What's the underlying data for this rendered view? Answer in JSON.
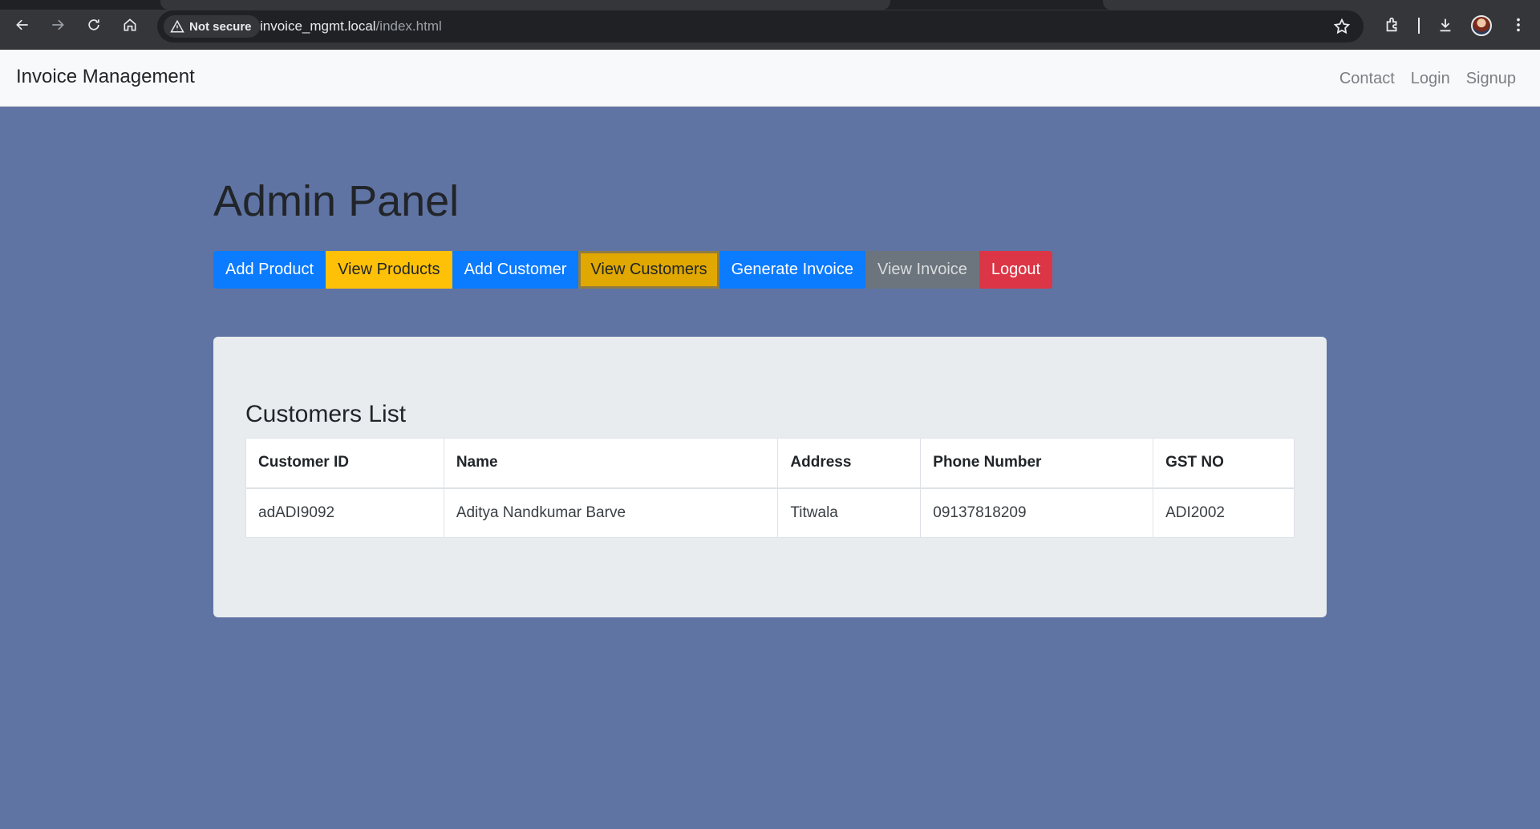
{
  "browser": {
    "security_label": "Not secure",
    "url_host": "invoice_mgmt.local",
    "url_path": "/index.html"
  },
  "navbar": {
    "brand": "Invoice Management",
    "links": [
      "Contact",
      "Login",
      "Signup"
    ]
  },
  "page": {
    "title": "Admin Panel"
  },
  "buttons": {
    "add_product": "Add Product",
    "view_products": "View Products",
    "add_customer": "Add Customer",
    "view_customers": "View Customers",
    "generate_invoice": "Generate Invoice",
    "view_invoice": "View Invoice",
    "logout": "Logout"
  },
  "customers": {
    "title": "Customers List",
    "columns": [
      "Customer ID",
      "Name",
      "Address",
      "Phone Number",
      "GST NO"
    ],
    "rows": [
      [
        "adADI9092",
        "Aditya Nandkumar Barve",
        "Titwala",
        "09137818209",
        "ADI2002"
      ]
    ]
  },
  "colors": {
    "background": "#6074a4",
    "primary": "#0b7bff",
    "warning": "#ffc107",
    "secondary": "#6c757d",
    "danger": "#dc3545"
  }
}
